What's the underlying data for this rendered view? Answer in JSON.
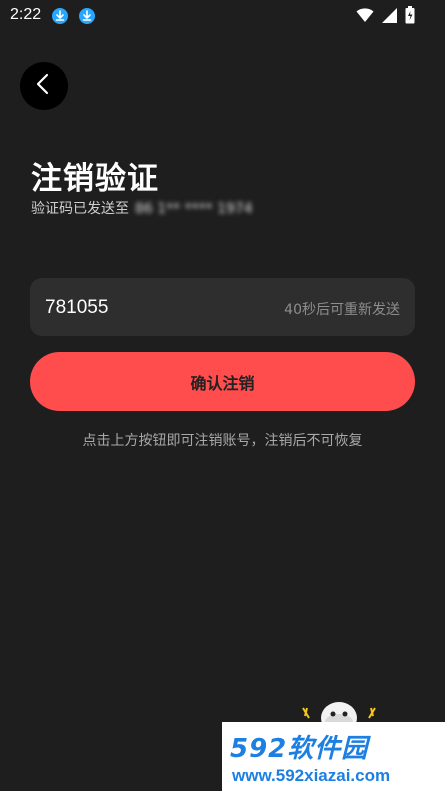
{
  "status_bar": {
    "time": "2:22",
    "icons": [
      "download-icon",
      "download-icon",
      "wifi-icon",
      "signal-icon",
      "battery-icon"
    ]
  },
  "back_button": {
    "icon": "chevron-left-icon"
  },
  "page": {
    "title": "注销验证",
    "subtitle": "验证码已发送至",
    "phone_masked": "86 1** **** 1974"
  },
  "code_input": {
    "value": "781055",
    "resend_label": "40秒后可重新发送"
  },
  "confirm_button": {
    "label": "确认注销"
  },
  "hint": "点击上方按钮即可注销账号，注销后不可恢复",
  "watermark": {
    "brand": "592软件园",
    "url": "www.592xiazai.com"
  },
  "colors": {
    "background": "#1e1e1e",
    "accent": "#ff4d4d",
    "input_bg": "#2e2e2e",
    "watermark": "#1d7fe2"
  }
}
